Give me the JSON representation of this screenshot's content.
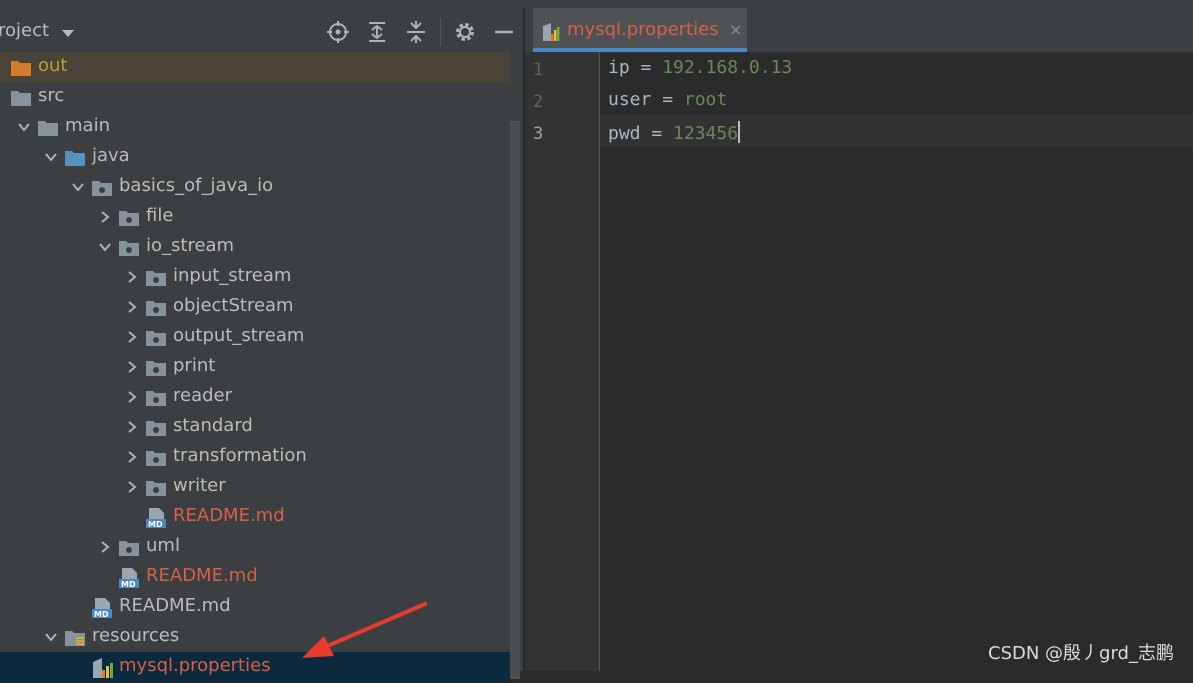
{
  "panel": {
    "title": "roject"
  },
  "tree": [
    {
      "label": "out",
      "type": "folder-orange",
      "depth": 0,
      "style": "olive",
      "expanded": null,
      "highlight": "out"
    },
    {
      "label": "src",
      "type": "folder",
      "depth": 0,
      "style": "normal",
      "expanded": null
    },
    {
      "label": "main",
      "type": "folder",
      "depth": 1,
      "style": "normal",
      "expanded": true
    },
    {
      "label": "java",
      "type": "folder-blue",
      "depth": 2,
      "style": "normal",
      "expanded": true
    },
    {
      "label": "basics_of_java_io",
      "type": "package",
      "depth": 3,
      "style": "normal",
      "expanded": true
    },
    {
      "label": "file",
      "type": "package",
      "depth": 4,
      "style": "normal",
      "expanded": false
    },
    {
      "label": "io_stream",
      "type": "package",
      "depth": 4,
      "style": "normal",
      "expanded": true
    },
    {
      "label": "input_stream",
      "type": "package",
      "depth": 5,
      "style": "normal",
      "expanded": false
    },
    {
      "label": "objectStream",
      "type": "package",
      "depth": 5,
      "style": "normal",
      "expanded": false
    },
    {
      "label": "output_stream",
      "type": "package",
      "depth": 5,
      "style": "normal",
      "expanded": false
    },
    {
      "label": "print",
      "type": "package",
      "depth": 5,
      "style": "normal",
      "expanded": false
    },
    {
      "label": "reader",
      "type": "package",
      "depth": 5,
      "style": "normal",
      "expanded": false
    },
    {
      "label": "standard",
      "type": "package",
      "depth": 5,
      "style": "normal",
      "expanded": false
    },
    {
      "label": "transformation",
      "type": "package",
      "depth": 5,
      "style": "normal",
      "expanded": false
    },
    {
      "label": "writer",
      "type": "package",
      "depth": 5,
      "style": "normal",
      "expanded": false
    },
    {
      "label": "README.md",
      "type": "md",
      "depth": 5,
      "style": "red",
      "expanded": null
    },
    {
      "label": "uml",
      "type": "package",
      "depth": 4,
      "style": "normal",
      "expanded": false
    },
    {
      "label": "README.md",
      "type": "md",
      "depth": 4,
      "style": "red",
      "expanded": null
    },
    {
      "label": "README.md",
      "type": "md",
      "depth": 3,
      "style": "normal",
      "expanded": null
    },
    {
      "label": "resources",
      "type": "folder-res",
      "depth": 2,
      "style": "normal",
      "expanded": true
    },
    {
      "label": "mysql.properties",
      "type": "properties",
      "depth": 3,
      "style": "red",
      "expanded": null,
      "highlight": "selected"
    }
  ],
  "editor": {
    "tab_label": "mysql.properties",
    "tab_close": "×",
    "lines": [
      {
        "num": "1",
        "key": "ip",
        "eq": " = ",
        "value": "192.168.0.13"
      },
      {
        "num": "2",
        "key": "user",
        "eq": " = ",
        "value": "root"
      },
      {
        "num": "3",
        "key": "pwd",
        "eq": " = ",
        "value": "123456"
      }
    ]
  },
  "watermark": "CSDN @殷丿grd_志鹏",
  "colors": {
    "panel_bg": "#3c3f41",
    "editor_bg": "#2b2b2b",
    "value_green": "#6a8759",
    "file_red": "#d75f4a",
    "selection": "#0d293e",
    "annotation_arrow": "#e83b2e"
  }
}
